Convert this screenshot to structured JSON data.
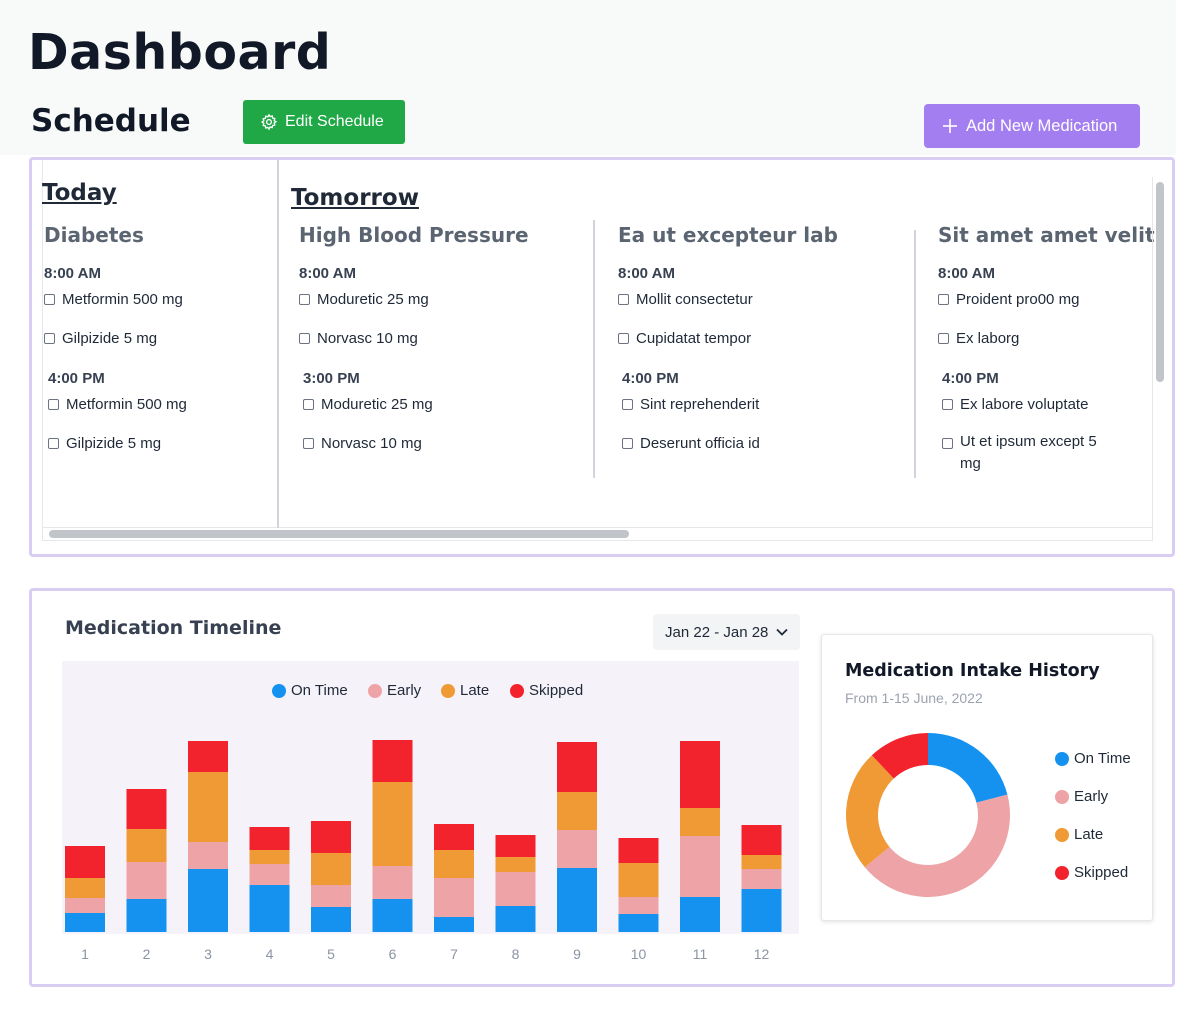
{
  "page": {
    "title": "Dashboard",
    "section_title": "Schedule"
  },
  "buttons": {
    "edit_schedule": "Edit Schedule",
    "add_medication": "Add New Medication"
  },
  "schedule": {
    "today": {
      "label": "Today",
      "columns": [
        {
          "condition": "Diabetes",
          "slots": [
            {
              "time": "8:00 AM",
              "meds": [
                "Metformin 500 mg",
                "Gilpizide 5 mg"
              ]
            },
            {
              "time": "4:00 PM",
              "meds": [
                "Metformin 500 mg",
                "Gilpizide 5 mg"
              ]
            }
          ]
        }
      ]
    },
    "tomorrow": {
      "label": "Tomorrow",
      "columns": [
        {
          "condition": "High Blood Pressure",
          "slots": [
            {
              "time": "8:00 AM",
              "meds": [
                "Moduretic 25 mg",
                "Norvasc 10 mg"
              ]
            },
            {
              "time": "3:00 PM",
              "meds": [
                "Moduretic 25 mg",
                "Norvasc 10 mg"
              ]
            }
          ]
        },
        {
          "condition": "Ea ut excepteur lab",
          "slots": [
            {
              "time": "8:00 AM",
              "meds": [
                "Mollit consectetur",
                "Cupidatat tempor"
              ]
            },
            {
              "time": "4:00 PM",
              "meds": [
                "Sint reprehenderit",
                "Deserunt officia id"
              ]
            }
          ]
        },
        {
          "condition": "Sit amet amet velit",
          "slots": [
            {
              "time": "8:00 AM",
              "meds": [
                "Proident pro00 mg",
                "Ex laborg"
              ]
            },
            {
              "time": "4:00 PM",
              "meds": [
                "Ex labore voluptate",
                "Ut et ipsum except 5 mg"
              ]
            }
          ]
        }
      ]
    }
  },
  "timeline": {
    "title": "Medication Timeline",
    "date_range": "Jan 22 - Jan 28",
    "legend": [
      "On Time",
      "Early",
      "Late",
      "Skipped"
    ]
  },
  "intake_history": {
    "title": "Medication Intake History",
    "subtitle": "From 1-15 June, 2022",
    "legend": [
      "On Time",
      "Early",
      "Late",
      "Skipped"
    ]
  },
  "colors": {
    "on_time": "#1592f0",
    "early": "#eea3a6",
    "late": "#ef9a35",
    "skipped": "#f2232d",
    "accent": "#a37ef0",
    "edit": "#1fa845"
  },
  "icons": {
    "edit": "gear-icon",
    "add": "plus-icon",
    "range": "chevron-down-icon"
  },
  "chart_data": [
    {
      "type": "bar",
      "stacked": true,
      "categories": [
        "1",
        "2",
        "3",
        "4",
        "5",
        "6",
        "7",
        "8",
        "9",
        "10",
        "11",
        "12"
      ],
      "series": [
        {
          "name": "On Time",
          "values": [
            19,
            33,
            63,
            47,
            25,
            33,
            15,
            26,
            64,
            18,
            35,
            43
          ]
        },
        {
          "name": "Early",
          "values": [
            15,
            37,
            27,
            21,
            22,
            33,
            39,
            34,
            38,
            17,
            61,
            20
          ]
        },
        {
          "name": "Late",
          "values": [
            20,
            33,
            70,
            14,
            32,
            84,
            28,
            15,
            38,
            34,
            28,
            14
          ]
        },
        {
          "name": "Skipped",
          "values": [
            32,
            40,
            31,
            23,
            32,
            42,
            26,
            22,
            50,
            25,
            67,
            30
          ]
        }
      ],
      "ylim": [
        0,
        200
      ]
    },
    {
      "type": "pie",
      "donut": true,
      "labels": [
        "On Time",
        "Early",
        "Late",
        "Skipped"
      ],
      "values": [
        21,
        43,
        24,
        12
      ]
    }
  ]
}
